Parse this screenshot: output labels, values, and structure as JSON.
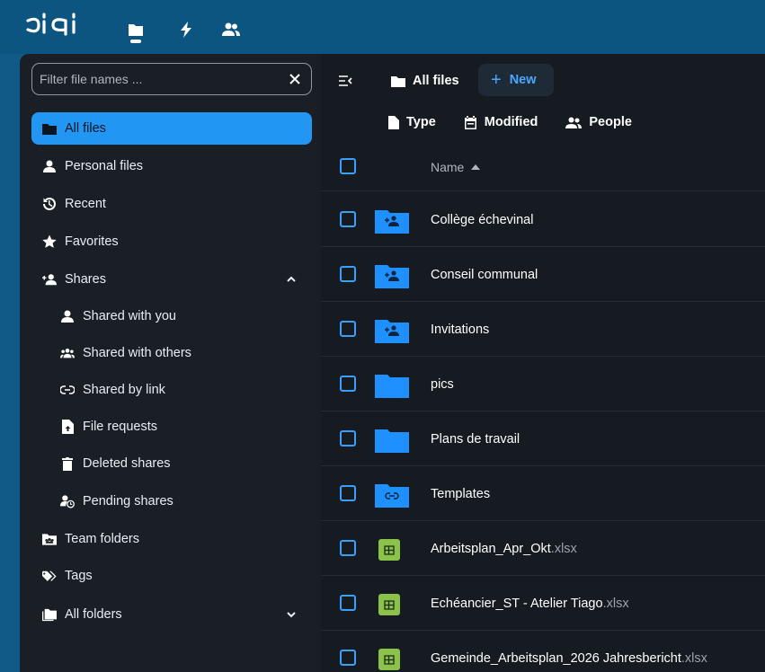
{
  "header": {
    "logo_text": "bigi",
    "icons": [
      "files-icon",
      "activity-icon",
      "contacts-icon"
    ]
  },
  "sidebar": {
    "filter": {
      "placeholder": "Filter file names ...",
      "value": ""
    },
    "items": [
      {
        "label": "All files",
        "icon": "folder-icon",
        "active": true
      },
      {
        "label": "Personal files",
        "icon": "user-icon"
      },
      {
        "label": "Recent",
        "icon": "history-icon"
      },
      {
        "label": "Favorites",
        "icon": "star-icon"
      },
      {
        "label": "Shares",
        "icon": "share-add-icon",
        "expanded": true
      },
      {
        "label": "Shared with you",
        "icon": "user-icon"
      },
      {
        "label": "Shared with others",
        "icon": "users-icon"
      },
      {
        "label": "Shared by link",
        "icon": "link-icon"
      },
      {
        "label": "File requests",
        "icon": "file-upload-icon"
      },
      {
        "label": "Deleted shares",
        "icon": "trash-icon"
      },
      {
        "label": "Pending shares",
        "icon": "user-clock-icon"
      },
      {
        "label": "Team folders",
        "icon": "team-folder-icon"
      },
      {
        "label": "Tags",
        "icon": "tag-icon"
      },
      {
        "label": "All folders",
        "icon": "folders-icon",
        "collapsed": true
      }
    ]
  },
  "main": {
    "breadcrumb": "All files",
    "new_label": "New",
    "filters": [
      {
        "label": "Type",
        "icon": "file-icon"
      },
      {
        "label": "Modified",
        "icon": "calendar-icon"
      },
      {
        "label": "People",
        "icon": "people-icon"
      }
    ],
    "list": {
      "name_header": "Name",
      "files": [
        {
          "name": "Collège échevinal",
          "ext": "",
          "kind": "shared-folder"
        },
        {
          "name": "Conseil communal",
          "ext": "",
          "kind": "shared-folder"
        },
        {
          "name": "Invitations",
          "ext": "",
          "kind": "shared-folder"
        },
        {
          "name": "pics",
          "ext": "",
          "kind": "folder"
        },
        {
          "name": "Plans de travail",
          "ext": "",
          "kind": "folder"
        },
        {
          "name": "Templates",
          "ext": "",
          "kind": "link-folder"
        },
        {
          "name": "Arbeitsplan_Apr_Okt",
          "ext": ".xlsx",
          "kind": "spreadsheet"
        },
        {
          "name": "Echéancier_ST - Atelier Tiago",
          "ext": ".xlsx",
          "kind": "spreadsheet"
        },
        {
          "name": "Gemeinde_Arbeitsplan_2026 Jahresbericht",
          "ext": ".xlsx",
          "kind": "spreadsheet"
        }
      ]
    }
  },
  "colors": {
    "header_bg": "#0c5581",
    "sidebar_bg": "#1a1f26",
    "main_bg": "#161b21",
    "accent": "#2196f3",
    "folder": "#1e90ff",
    "spreadsheet": "#8bc34a"
  }
}
